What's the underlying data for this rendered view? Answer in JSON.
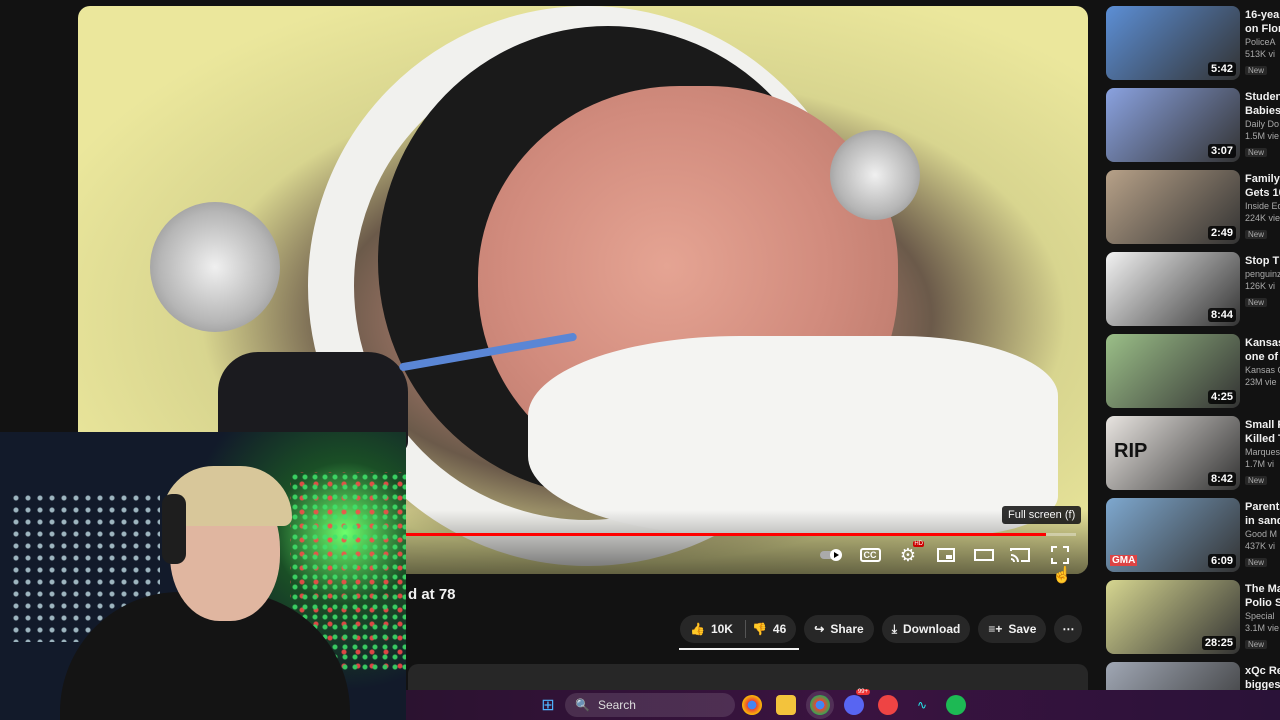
{
  "player": {
    "progress_fraction": 0.97,
    "tooltip": "Full screen (f)",
    "watermark": "",
    "controls": {
      "autoplay_icon": "toggle-icon",
      "cc_label": "CC",
      "settings_badge": "HD"
    }
  },
  "video": {
    "title_fragment": "d at 78",
    "like_count": "10K",
    "dislike_count": "46",
    "share_label": "Share",
    "download_label": "Download",
    "save_label": "Save",
    "more_label": "⋯"
  },
  "sidebar": {
    "items": [
      {
        "title": "16-yea",
        "title2": "on Flor",
        "channel": "PoliceA",
        "views": "513K vi",
        "badge": "New",
        "duration": "5:42",
        "color": "#5c8fd6"
      },
      {
        "title": "Studen",
        "title2": "Babies",
        "channel": "Daily Do",
        "views": "1.5M vie",
        "badge": "New",
        "duration": "3:07",
        "color": "#8aa2e0"
      },
      {
        "title": "Family",
        "title2": "Gets 10",
        "channel": "Inside Ed",
        "views": "224K vie",
        "badge": "New",
        "duration": "2:49",
        "color": "#b7a188"
      },
      {
        "title": "Stop Th",
        "title2": "",
        "channel": "penguinz",
        "views": "126K vi",
        "badge": "New",
        "duration": "8:44",
        "color": "#f2f2f2"
      },
      {
        "title": "Kansas",
        "title2": "one of",
        "channel": "Kansas C",
        "views": "23M vie",
        "badge": "",
        "duration": "4:25",
        "color": "#9bbf88"
      },
      {
        "title": "Small P",
        "title2": "Killed T",
        "channel": "Marques",
        "views": "1.7M vi",
        "badge": "New",
        "duration": "8:42",
        "color": "#e8e4e0"
      },
      {
        "title": "Parents",
        "title2": "in sand",
        "channel": "Good M",
        "views": "437K vi",
        "badge": "New",
        "duration": "6:09",
        "color": "#7ea8cf"
      },
      {
        "title": "The Ma",
        "title2": "Polio S",
        "channel": "Special",
        "views": "3.1M vie",
        "badge": "New",
        "duration": "28:25",
        "color": "#d6d690"
      },
      {
        "title": "xQc Re",
        "title2": "bigges",
        "channel": "",
        "views": "",
        "badge": "",
        "duration": "",
        "color": "#a0a7b4"
      }
    ]
  },
  "thumb_texts": {
    "rip": "RIP",
    "gma": "GMA"
  },
  "taskbar": {
    "search_placeholder": "Search",
    "notification_badge": "99+",
    "apps": [
      "windows-start-icon",
      "chrome-icon",
      "file-explorer-icon",
      "chrome-active-icon",
      "discord-icon",
      "app-icon",
      "waveform-icon",
      "spotify-icon"
    ]
  }
}
